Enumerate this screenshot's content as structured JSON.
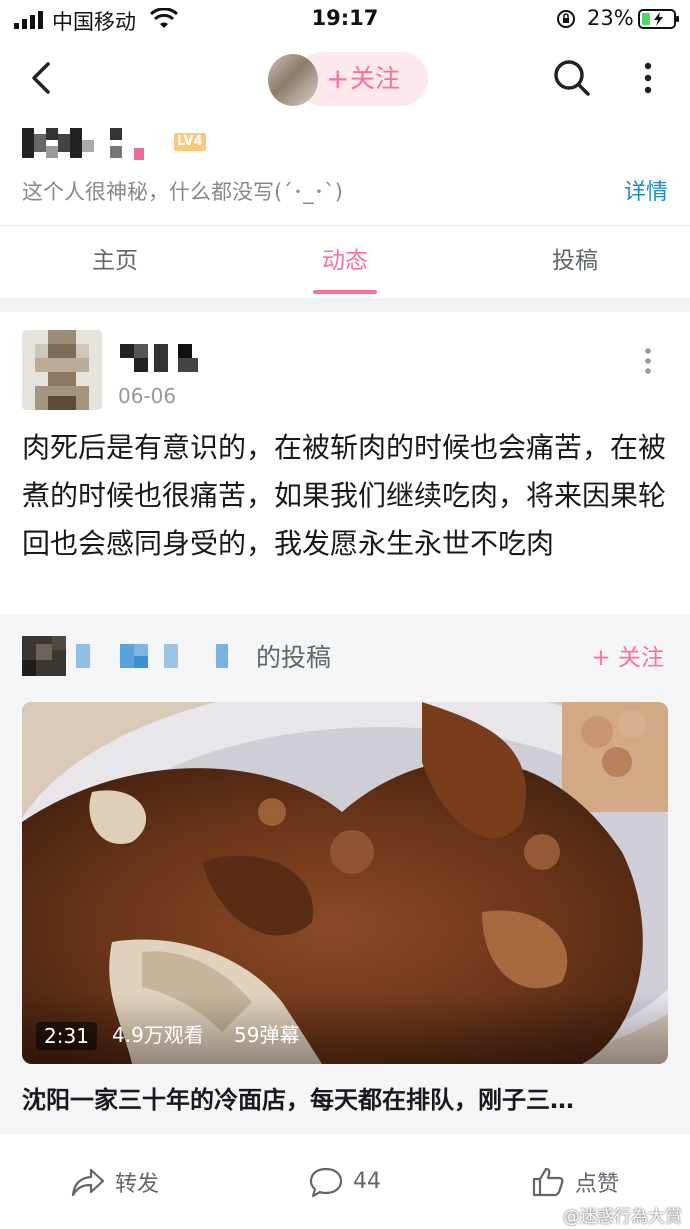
{
  "status_bar": {
    "carrier": "中国移动",
    "time": "19:17",
    "battery_percent": "23%"
  },
  "nav": {
    "follow_label": "关注",
    "follow_plus": "+"
  },
  "profile": {
    "level_badge": "LV4",
    "bio": "这个人很神秘，什么都没写(´･_･`)",
    "detail_link": "详情"
  },
  "tabs": [
    {
      "label": "主页"
    },
    {
      "label": "动态",
      "active": true
    },
    {
      "label": "投稿"
    }
  ],
  "post": {
    "date": "06-06",
    "text": "肉死后是有意识的，在被斩肉的时候也会痛苦，在被煮的时候也很痛苦，如果我们继续吃肉，将来因果轮回也会感同身受的，我发愿永生永世不吃肉"
  },
  "repost": {
    "of_post_label": "的投稿",
    "follow_label": "+ 关注",
    "video": {
      "duration": "2:31",
      "views": "4.9万观看",
      "danmaku": "59弹幕"
    },
    "title": "沈阳一家三十年的冷面店，每天都在排队，刚子三…"
  },
  "actions": {
    "share_label": "转发",
    "comment_count": "44",
    "like_label": "点赞"
  },
  "watermark": "@迷惑行為大賞",
  "colors": {
    "accent": "#fb7299",
    "link": "#178bcf",
    "text": "#18191c",
    "muted": "#9499a0"
  }
}
